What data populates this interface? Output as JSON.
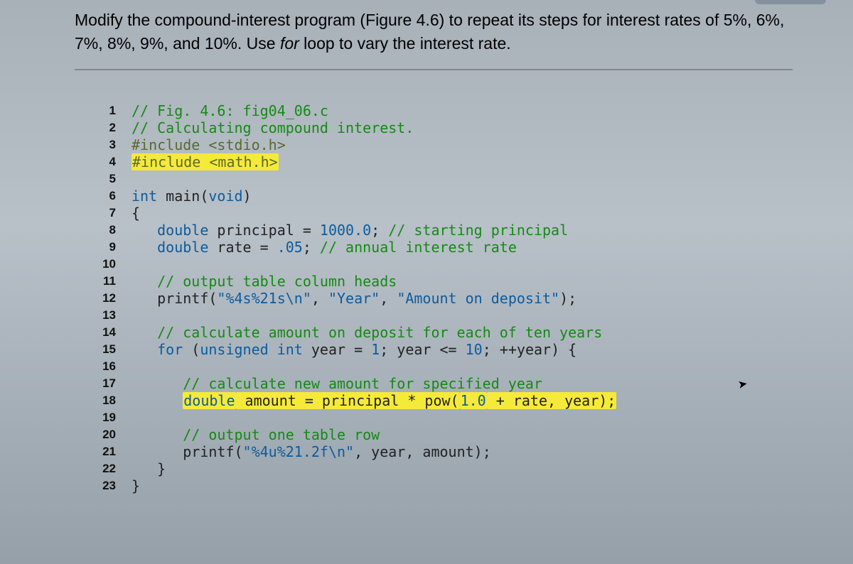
{
  "question": {
    "text_before_em": "Modify the compound-interest program (Figure 4.6) to repeat its steps for interest rates of 5%, 6%, 7%, 8%, 9%, and 10%. Use ",
    "em": "for",
    "text_after_em": " loop to vary the interest rate."
  },
  "code": {
    "lines": [
      {
        "n": "1",
        "seg": [
          {
            "cls": "c-comment",
            "t": "// Fig. 4.6: fig04_06.c"
          }
        ]
      },
      {
        "n": "2",
        "seg": [
          {
            "cls": "c-comment",
            "t": "// Calculating compound interest."
          }
        ]
      },
      {
        "n": "3",
        "seg": [
          {
            "cls": "c-pre",
            "t": "#include <stdio.h>"
          }
        ]
      },
      {
        "n": "4",
        "seg": [
          {
            "cls": "c-pre hl",
            "t": "#include <math.h>"
          }
        ]
      },
      {
        "n": "5",
        "seg": [
          {
            "cls": "c-txt",
            "t": ""
          }
        ]
      },
      {
        "n": "6",
        "seg": [
          {
            "cls": "c-key",
            "t": "int"
          },
          {
            "cls": "c-txt",
            "t": " main("
          },
          {
            "cls": "c-key",
            "t": "void"
          },
          {
            "cls": "c-txt",
            "t": ")"
          }
        ]
      },
      {
        "n": "7",
        "seg": [
          {
            "cls": "c-txt",
            "t": "{"
          }
        ]
      },
      {
        "n": "8",
        "seg": [
          {
            "cls": "c-txt",
            "t": "   "
          },
          {
            "cls": "c-key",
            "t": "double"
          },
          {
            "cls": "c-txt",
            "t": " principal = "
          },
          {
            "cls": "c-num",
            "t": "1000.0"
          },
          {
            "cls": "c-txt",
            "t": "; "
          },
          {
            "cls": "c-comment",
            "t": "// starting principal"
          }
        ]
      },
      {
        "n": "9",
        "seg": [
          {
            "cls": "c-txt",
            "t": "   "
          },
          {
            "cls": "c-key",
            "t": "double"
          },
          {
            "cls": "c-txt",
            "t": " rate = "
          },
          {
            "cls": "c-num",
            "t": ".05"
          },
          {
            "cls": "c-txt",
            "t": "; "
          },
          {
            "cls": "c-comment",
            "t": "// annual interest rate"
          }
        ]
      },
      {
        "n": "10",
        "seg": [
          {
            "cls": "c-txt",
            "t": ""
          }
        ]
      },
      {
        "n": "11",
        "seg": [
          {
            "cls": "c-txt",
            "t": "   "
          },
          {
            "cls": "c-comment",
            "t": "// output table column heads"
          }
        ]
      },
      {
        "n": "12",
        "seg": [
          {
            "cls": "c-txt",
            "t": "   printf("
          },
          {
            "cls": "c-str",
            "t": "\"%4s%21s\\n\""
          },
          {
            "cls": "c-txt",
            "t": ", "
          },
          {
            "cls": "c-str",
            "t": "\"Year\""
          },
          {
            "cls": "c-txt",
            "t": ", "
          },
          {
            "cls": "c-str",
            "t": "\"Amount on deposit\""
          },
          {
            "cls": "c-txt",
            "t": ");"
          }
        ]
      },
      {
        "n": "13",
        "seg": [
          {
            "cls": "c-txt",
            "t": ""
          }
        ]
      },
      {
        "n": "14",
        "seg": [
          {
            "cls": "c-txt",
            "t": "   "
          },
          {
            "cls": "c-comment",
            "t": "// calculate amount on deposit for each of ten years"
          }
        ]
      },
      {
        "n": "15",
        "seg": [
          {
            "cls": "c-txt",
            "t": "   "
          },
          {
            "cls": "c-key",
            "t": "for"
          },
          {
            "cls": "c-txt",
            "t": " ("
          },
          {
            "cls": "c-key",
            "t": "unsigned int"
          },
          {
            "cls": "c-txt",
            "t": " year = "
          },
          {
            "cls": "c-num",
            "t": "1"
          },
          {
            "cls": "c-txt",
            "t": "; year <= "
          },
          {
            "cls": "c-num",
            "t": "10"
          },
          {
            "cls": "c-txt",
            "t": "; ++year) {"
          }
        ]
      },
      {
        "n": "16",
        "seg": [
          {
            "cls": "c-txt",
            "t": ""
          }
        ]
      },
      {
        "n": "17",
        "seg": [
          {
            "cls": "c-txt",
            "t": "      "
          },
          {
            "cls": "c-comment",
            "t": "// calculate new amount for specified year"
          }
        ]
      },
      {
        "n": "18",
        "seg": [
          {
            "cls": "c-txt",
            "t": "      "
          },
          {
            "cls": "c-key hl",
            "t": "double"
          },
          {
            "cls": "c-txt hl",
            "t": " amount = principal * pow("
          },
          {
            "cls": "c-num hl",
            "t": "1.0"
          },
          {
            "cls": "c-txt hl",
            "t": " + rate, year);"
          }
        ]
      },
      {
        "n": "19",
        "seg": [
          {
            "cls": "c-txt",
            "t": ""
          }
        ]
      },
      {
        "n": "20",
        "seg": [
          {
            "cls": "c-txt",
            "t": "      "
          },
          {
            "cls": "c-comment",
            "t": "// output one table row"
          }
        ]
      },
      {
        "n": "21",
        "seg": [
          {
            "cls": "c-txt",
            "t": "      printf("
          },
          {
            "cls": "c-str",
            "t": "\"%4u%21.2f\\n\""
          },
          {
            "cls": "c-txt",
            "t": ", year, amount);"
          }
        ]
      },
      {
        "n": "22",
        "seg": [
          {
            "cls": "c-txt",
            "t": "   }"
          }
        ]
      },
      {
        "n": "23",
        "seg": [
          {
            "cls": "c-txt",
            "t": "}"
          }
        ]
      }
    ]
  }
}
